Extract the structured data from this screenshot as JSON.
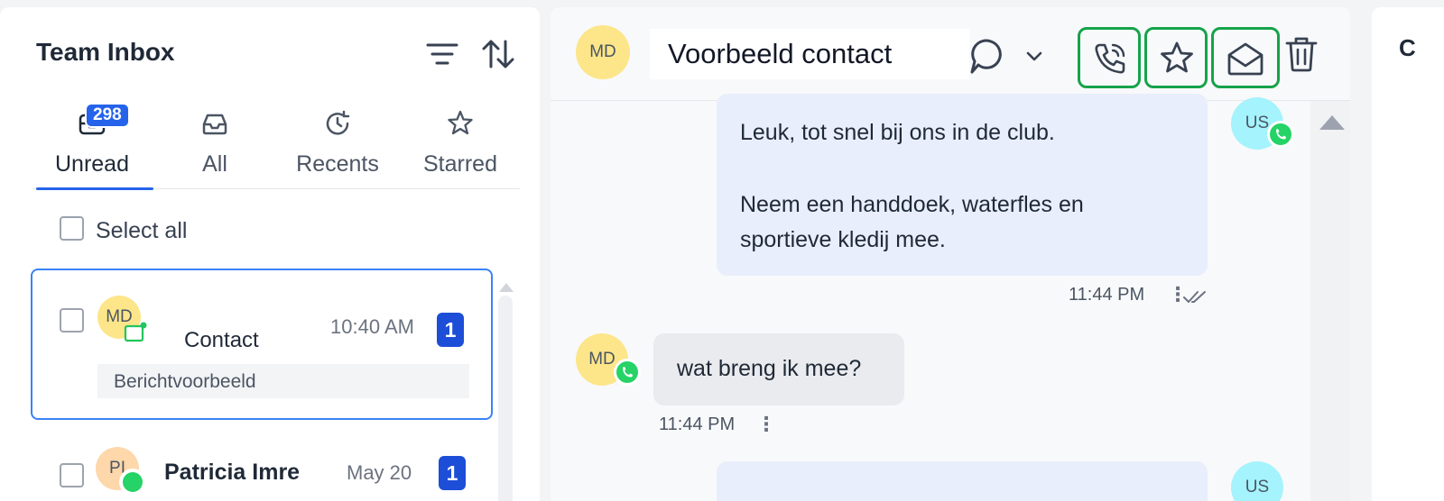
{
  "left_panel": {
    "title": "Team Inbox",
    "tabs": [
      {
        "label": "Unread",
        "badge": "298",
        "icon": "inbox-icon"
      },
      {
        "label": "All",
        "icon": "tray-icon"
      },
      {
        "label": "Recents",
        "icon": "clock-icon"
      },
      {
        "label": "Starred",
        "icon": "star-icon"
      }
    ],
    "select_all_label": "Select all",
    "conversations": [
      {
        "avatar": "MD",
        "name": "Contact",
        "time": "10:40 AM",
        "preview": "Berichtvoorbeeld",
        "unread": "1",
        "selected": true
      },
      {
        "avatar": "PI",
        "name": "Patricia Imre",
        "time": "May 20",
        "unread": "1",
        "selected": false
      }
    ]
  },
  "chat": {
    "contact_avatar": "MD",
    "contact_name": "Voorbeeld contact",
    "messages": [
      {
        "direction": "out",
        "avatar": "US",
        "lines": [
          "Leuk, tot snel bij ons in de club.",
          "",
          "Neem een handdoek, waterfles en",
          "sportieve kledij mee."
        ],
        "time": "11:44 PM"
      },
      {
        "direction": "in",
        "avatar": "MD",
        "lines": [
          "wat breng ik mee?"
        ],
        "time": "11:44 PM"
      },
      {
        "direction": "out",
        "avatar": "US",
        "lines": [
          ""
        ]
      }
    ]
  },
  "right_panel": {
    "letter": "C"
  },
  "colors": {
    "accent": "#2563eb",
    "highlight": "#16a34a",
    "whatsapp": "#25d366"
  }
}
